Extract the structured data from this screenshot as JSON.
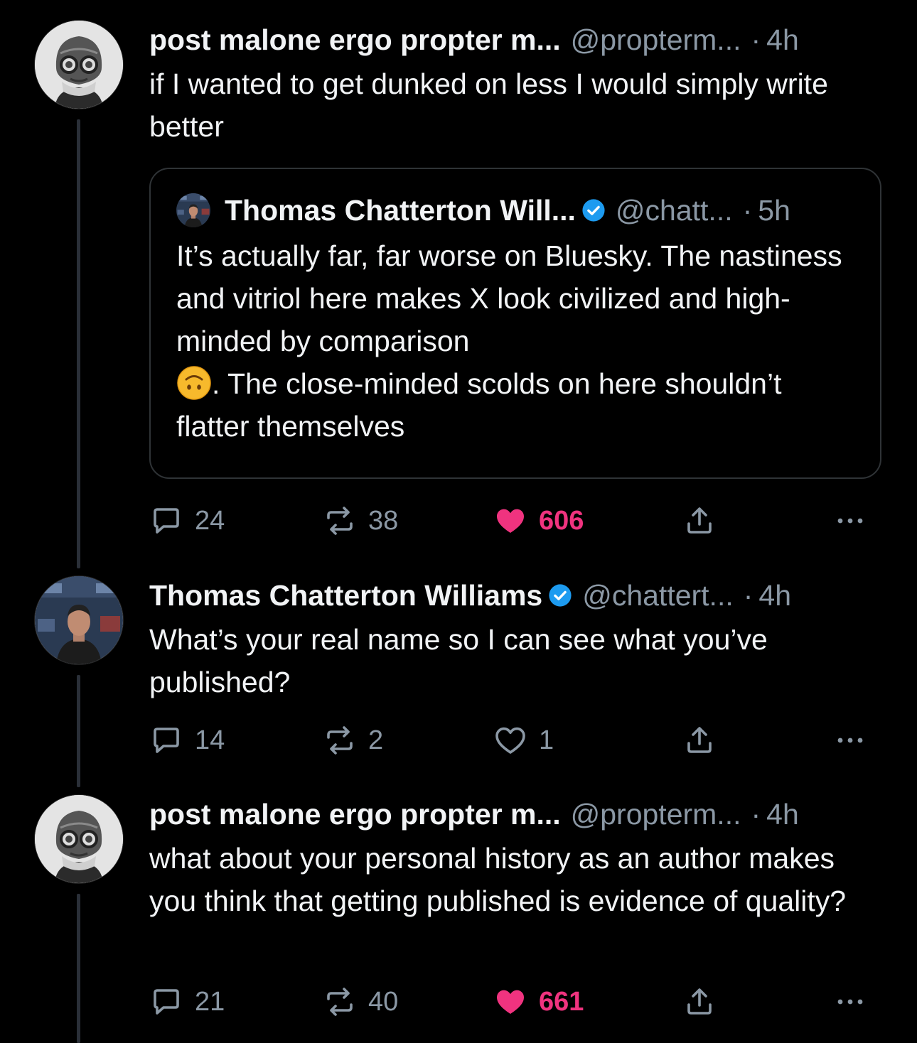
{
  "colors": {
    "background": "#000000",
    "text": "#f1f3f5",
    "muted": "#8b98a5",
    "like": "#f0337f",
    "verified": "#1d9bf0",
    "border": "#2f3336"
  },
  "posts": [
    {
      "display_name": "post malone ergo propter m...",
      "handle": "@propterm...",
      "separator": "·",
      "time": "4h",
      "text": "if I wanted to get dunked on less I would simply write better",
      "avatar_icon": "masked-helmet-avatar",
      "quote": {
        "display_name": "Thomas Chatterton Will...",
        "verified": true,
        "handle": "@chatt...",
        "separator": "·",
        "time": "5h",
        "text_before_emoji": "It’s actually far, far worse on Bluesky. The nastiness and vitriol here makes X look civilized and high-minded by comparison",
        "emoji": "upside-down-face-emoji",
        "text_after_emoji": ". The close-minded scolds on here shouldn’t flatter themselves"
      },
      "actions": {
        "replies": "24",
        "reposts": "38",
        "likes": "606",
        "liked": true
      }
    },
    {
      "display_name": "Thomas Chatterton Williams",
      "verified": true,
      "handle": "@chattert...",
      "separator": "·",
      "time": "4h",
      "text": "What’s your real name so I can see what you’ve published?",
      "avatar_icon": "tv-studio-avatar",
      "actions": {
        "replies": "14",
        "reposts": "2",
        "likes": "1",
        "liked": false
      }
    },
    {
      "display_name": "post malone ergo propter m...",
      "handle": "@propterm...",
      "separator": "·",
      "time": "4h",
      "text": "what about your personal history as an author makes you think that getting published is evidence of quality?",
      "avatar_icon": "masked-helmet-avatar",
      "actions": {
        "replies": "21",
        "reposts": "40",
        "likes": "661",
        "liked": true
      }
    }
  ]
}
